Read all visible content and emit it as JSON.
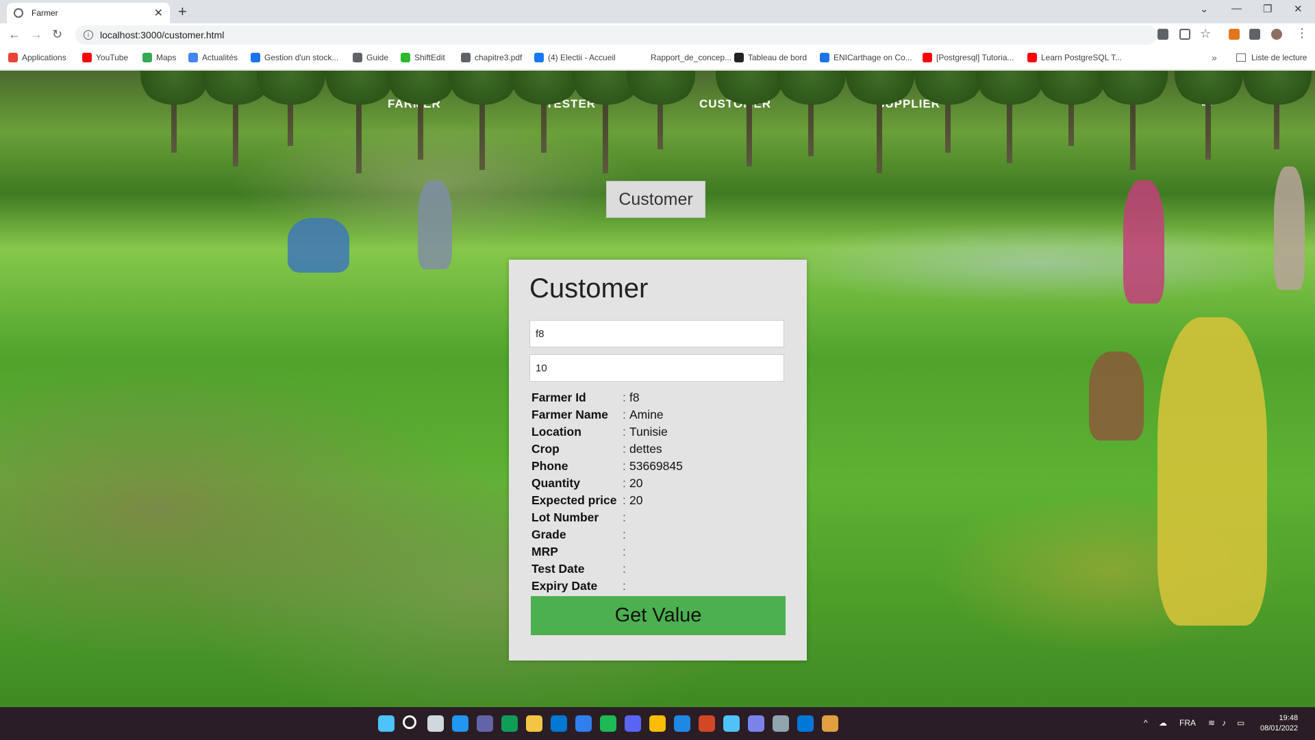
{
  "browser": {
    "tab_title": "Farmer",
    "url": "localhost:3000/customer.html",
    "bookmarks": [
      {
        "label": "Applications",
        "color": "#ea4335"
      },
      {
        "label": "YouTube",
        "color": "#ff0000"
      },
      {
        "label": "Maps",
        "color": "#34a853"
      },
      {
        "label": "Actualités",
        "color": "#4285f4"
      },
      {
        "label": "Gestion d'un stock...",
        "color": "#1a73e8"
      },
      {
        "label": "Guide",
        "color": "#5f6368"
      },
      {
        "label": "ShiftEdit",
        "color": "#2eb82e"
      },
      {
        "label": "chapitre3.pdf",
        "color": "#5f6368"
      },
      {
        "label": "(4) Electii - Accueil",
        "color": "#1877f2"
      },
      {
        "label": "Rapport_de_concep...",
        "color": "#ffffff"
      },
      {
        "label": "Tableau de bord",
        "color": "#202124"
      },
      {
        "label": "ENICarthage on Co...",
        "color": "#1a73e8"
      },
      {
        "label": "[Postgresql] Tutoria...",
        "color": "#ff0000"
      },
      {
        "label": "Learn PostgreSQL T...",
        "color": "#ff0000"
      }
    ],
    "reading_list": "Liste de lecture",
    "more": "»"
  },
  "nav": {
    "items": [
      "FARMER",
      "TESTER",
      "CUSTOMER",
      "SUPPLIER"
    ]
  },
  "header_button": "Customer",
  "form": {
    "title": "Customer",
    "farmer_id_input": "f8",
    "quantity_input": "10",
    "fields": [
      {
        "label": "Farmer Id",
        "value": "f8"
      },
      {
        "label": "Farmer Name",
        "value": "Amine"
      },
      {
        "label": "Location",
        "value": "Tunisie"
      },
      {
        "label": "Crop",
        "value": "dettes"
      },
      {
        "label": "Phone",
        "value": "53669845"
      },
      {
        "label": "Quantity",
        "value": "20"
      },
      {
        "label": "Expected price",
        "value": "20"
      },
      {
        "label": "Lot Number",
        "value": ""
      },
      {
        "label": "Grade",
        "value": ""
      },
      {
        "label": "MRP",
        "value": ""
      },
      {
        "label": "Test Date",
        "value": ""
      },
      {
        "label": "Expiry Date",
        "value": ""
      }
    ],
    "separator": ":",
    "submit_label": "Get Value"
  },
  "taskbar": {
    "language": "FRA",
    "time": "19:48",
    "date": "08/01/2022",
    "apps": [
      {
        "name": "start-icon",
        "color": "#4cc2ff"
      },
      {
        "name": "search-icon",
        "color": "#ffffff"
      },
      {
        "name": "task-view-icon",
        "color": "#cfd8dc"
      },
      {
        "name": "widgets-icon",
        "color": "#2196f3"
      },
      {
        "name": "teams-chat-icon",
        "color": "#6264a7"
      },
      {
        "name": "edge-icon",
        "color": "#0f9d58"
      },
      {
        "name": "file-explorer-icon",
        "color": "#f4c542"
      },
      {
        "name": "mail-icon",
        "color": "#0078d4"
      },
      {
        "name": "todo-icon",
        "color": "#2f80ed"
      },
      {
        "name": "spotify-icon",
        "color": "#1db954"
      },
      {
        "name": "discord-icon",
        "color": "#5865f2"
      },
      {
        "name": "chrome-icon",
        "color": "#fbbc05"
      },
      {
        "name": "photos-icon",
        "color": "#1e88e5"
      },
      {
        "name": "powerpoint-icon",
        "color": "#d24726"
      },
      {
        "name": "remote-desktop-icon",
        "color": "#4fc3f7"
      },
      {
        "name": "teams-icon",
        "color": "#7b83eb"
      },
      {
        "name": "settings-icon",
        "color": "#90a4ae"
      },
      {
        "name": "vscode-icon",
        "color": "#0078d7"
      },
      {
        "name": "package-icon",
        "color": "#e0a040"
      }
    ]
  }
}
